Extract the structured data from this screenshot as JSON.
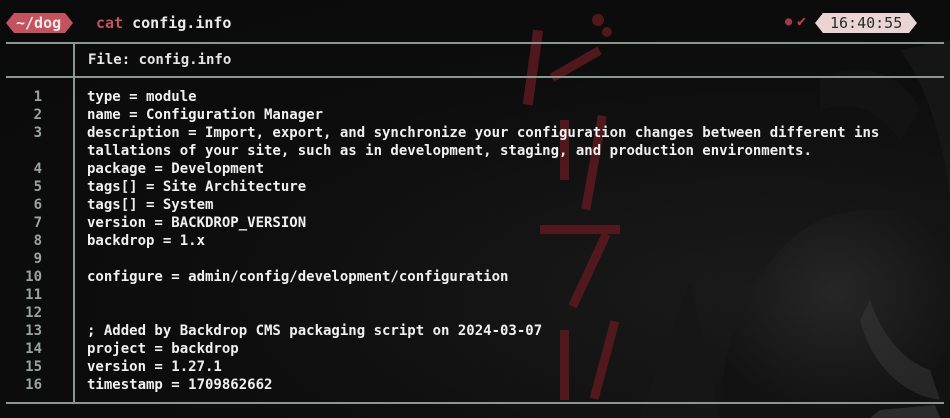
{
  "prompt": {
    "cwd": "~/dog",
    "command": "cat",
    "argument": "config.info",
    "status_icon": "check-icon",
    "time": "16:40:55"
  },
  "file": {
    "header": "File: config.info"
  },
  "lines": [
    {
      "num": "1",
      "text": "type = module"
    },
    {
      "num": "2",
      "text": "name = Configuration Manager"
    },
    {
      "num": "3",
      "text": "description = Import, export, and synchronize your configuration changes between different ins"
    },
    {
      "num": "",
      "text": "tallations of your site, such as in development, staging, and production environments."
    },
    {
      "num": "4",
      "text": "package = Development"
    },
    {
      "num": "5",
      "text": "tags[] = Site Architecture"
    },
    {
      "num": "6",
      "text": "tags[] = System"
    },
    {
      "num": "7",
      "text": "version = BACKDROP_VERSION"
    },
    {
      "num": "8",
      "text": "backdrop = 1.x"
    },
    {
      "num": "9",
      "text": ""
    },
    {
      "num": "10",
      "text": "configure = admin/config/development/configuration"
    },
    {
      "num": "11",
      "text": ""
    },
    {
      "num": "12",
      "text": ""
    },
    {
      "num": "13",
      "text": "; Added by Backdrop CMS packaging script on 2024-03-07"
    },
    {
      "num": "14",
      "text": "project = backdrop"
    },
    {
      "num": "15",
      "text": "version = 1.27.1"
    },
    {
      "num": "16",
      "text": "timestamp = 1709862662"
    }
  ],
  "colors": {
    "accent": "#c2535f",
    "time_badge": "#ead4d4",
    "frame": "#8a9691",
    "background": "#0c0c0c"
  }
}
